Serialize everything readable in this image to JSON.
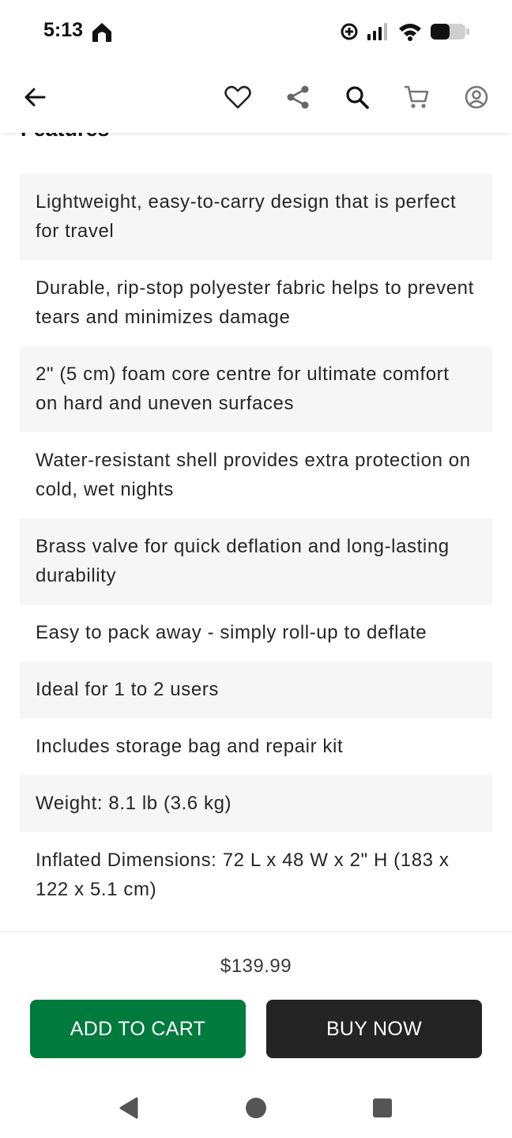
{
  "status_bar": {
    "time": "5:13",
    "icons": [
      "home-notification-icon",
      "data-saver-icon",
      "signal-icon",
      "wifi-icon",
      "battery-icon"
    ]
  },
  "app_bar": {
    "icons": [
      "back-arrow-icon",
      "heart-icon",
      "share-icon",
      "search-icon",
      "cart-icon",
      "account-icon"
    ]
  },
  "section": {
    "title": "Features"
  },
  "features": [
    "Lightweight, easy-to-carry design that is perfect for travel",
    "Durable, rip-stop polyester fabric helps to prevent tears and minimizes damage",
    "2\" (5 cm) foam core centre for ultimate comfort on hard and uneven surfaces",
    "Water-resistant shell provides extra protection on cold, wet nights",
    "Brass valve for quick deflation and long-lasting durability",
    "Easy to pack away - simply roll-up to deflate",
    "Ideal for 1 to 2 users",
    "Includes storage bag and repair kit",
    "Weight: 8.1 lb (3.6 kg)",
    "Inflated Dimensions: 72 L x 48 W x 2\" H (183 x 122 x 5.1 cm)"
  ],
  "purchase": {
    "price": "$139.99",
    "add_to_cart_label": "ADD TO CART",
    "buy_now_label": "BUY NOW"
  },
  "colors": {
    "add_to_cart": "#007a3d",
    "buy_now": "#242424",
    "row_shade": "#f6f6f6"
  },
  "nav_bar": {
    "icons": [
      "back-triangle-icon",
      "home-circle-icon",
      "recents-square-icon"
    ]
  }
}
